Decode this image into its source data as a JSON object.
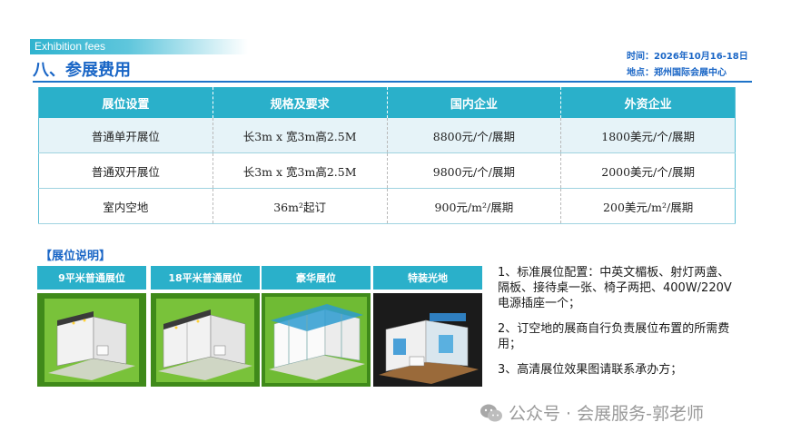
{
  "header": {
    "tag": "Exhibition fees",
    "title": "八、参展费用",
    "time": "时间：2026年10月16-18日",
    "place": "地点：郑州国际会展中心"
  },
  "fee_table": {
    "headers": [
      "展位设置",
      "规格及要求",
      "国内企业",
      "外资企业"
    ],
    "rows": [
      [
        "普通单开展位",
        "长3m x 宽3m高2.5M",
        "8800元/个/展期",
        "1800美元/个/展期"
      ],
      [
        "普通双开展位",
        "长3m x 宽3m高2.5M",
        "9800元/个/展期",
        "2000美元/个/展期"
      ],
      [
        "室内空地",
        "36m²起订",
        "900元/m²/展期",
        "200美元/m²/展期"
      ]
    ]
  },
  "booth_section": {
    "title": "【展位说明】",
    "cards": [
      {
        "label": "9平米普通展位"
      },
      {
        "label": "18平米普通展位"
      },
      {
        "label": "豪华展位"
      },
      {
        "label": "特装光地"
      }
    ]
  },
  "notes": [
    "1、标准展位配置：中英文楣板、射灯两盏、隔板、接待桌一张、椅子两把、400W/220V电源插座一个；",
    "2、订空地的展商自行负责展位布置的所需费用；",
    "3、高清展位效果图请联系承办方；"
  ],
  "watermark": {
    "text": "公众号 · 会展服务-郭老师",
    "icon": "wechat-icon"
  },
  "colors": {
    "accent": "#2ab0ca",
    "title_blue": "#1a66c6",
    "row_alt": "#e6f3f8"
  }
}
